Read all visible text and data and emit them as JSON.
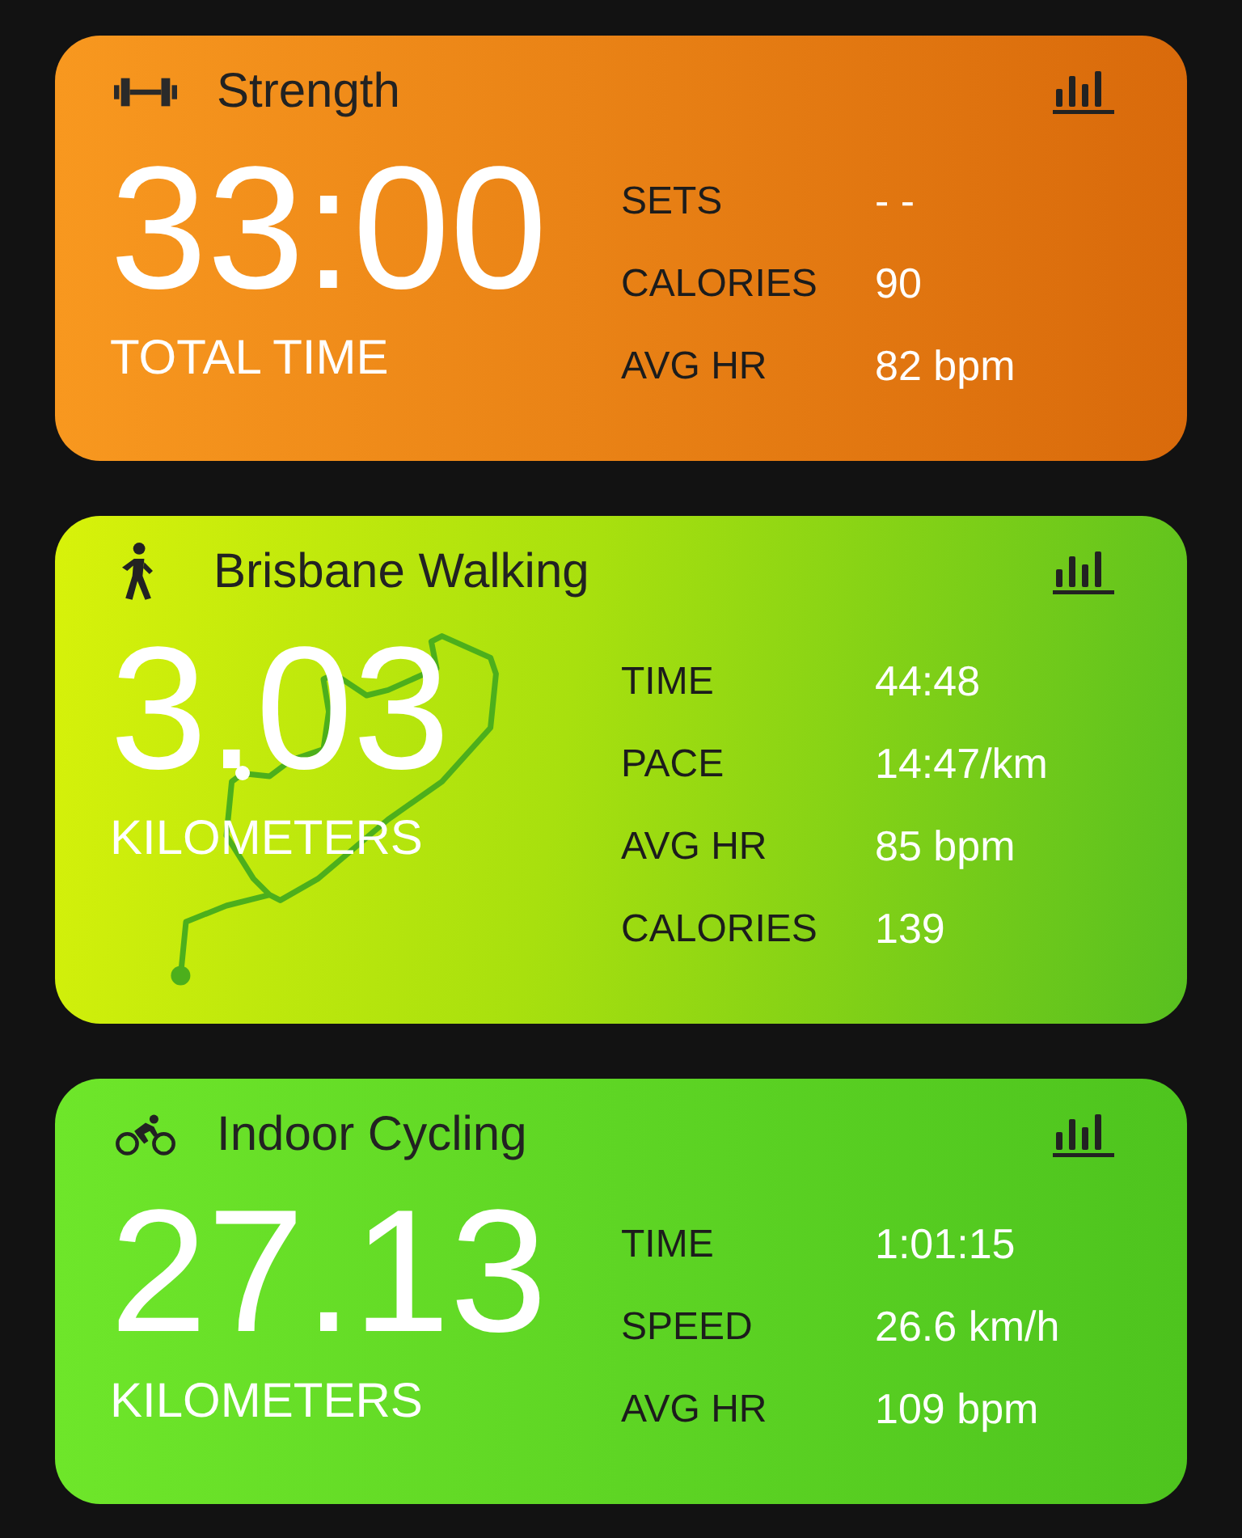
{
  "cards": [
    {
      "kind": "strength",
      "title": "Strength",
      "value": "33:00",
      "unit": "TOTAL TIME",
      "route": false,
      "stats": [
        {
          "label": "SETS",
          "value": "- -"
        },
        {
          "label": "CALORIES",
          "value": "90"
        },
        {
          "label": "AVG HR",
          "value": "82 bpm"
        }
      ]
    },
    {
      "kind": "walking",
      "title": "Brisbane Walking",
      "value": "3.03",
      "unit": "KILOMETERS",
      "route": true,
      "stats": [
        {
          "label": "TIME",
          "value": "44:48"
        },
        {
          "label": "PACE",
          "value": "14:47/km"
        },
        {
          "label": "AVG HR",
          "value": "85 bpm"
        },
        {
          "label": "CALORIES",
          "value": "139"
        }
      ]
    },
    {
      "kind": "cycling",
      "title": "Indoor Cycling",
      "value": "27.13",
      "unit": "KILOMETERS",
      "route": false,
      "stats": [
        {
          "label": "TIME",
          "value": "1:01:15"
        },
        {
          "label": "SPEED",
          "value": "26.6 km/h"
        },
        {
          "label": "AVG HR",
          "value": "109 bpm"
        }
      ]
    }
  ]
}
